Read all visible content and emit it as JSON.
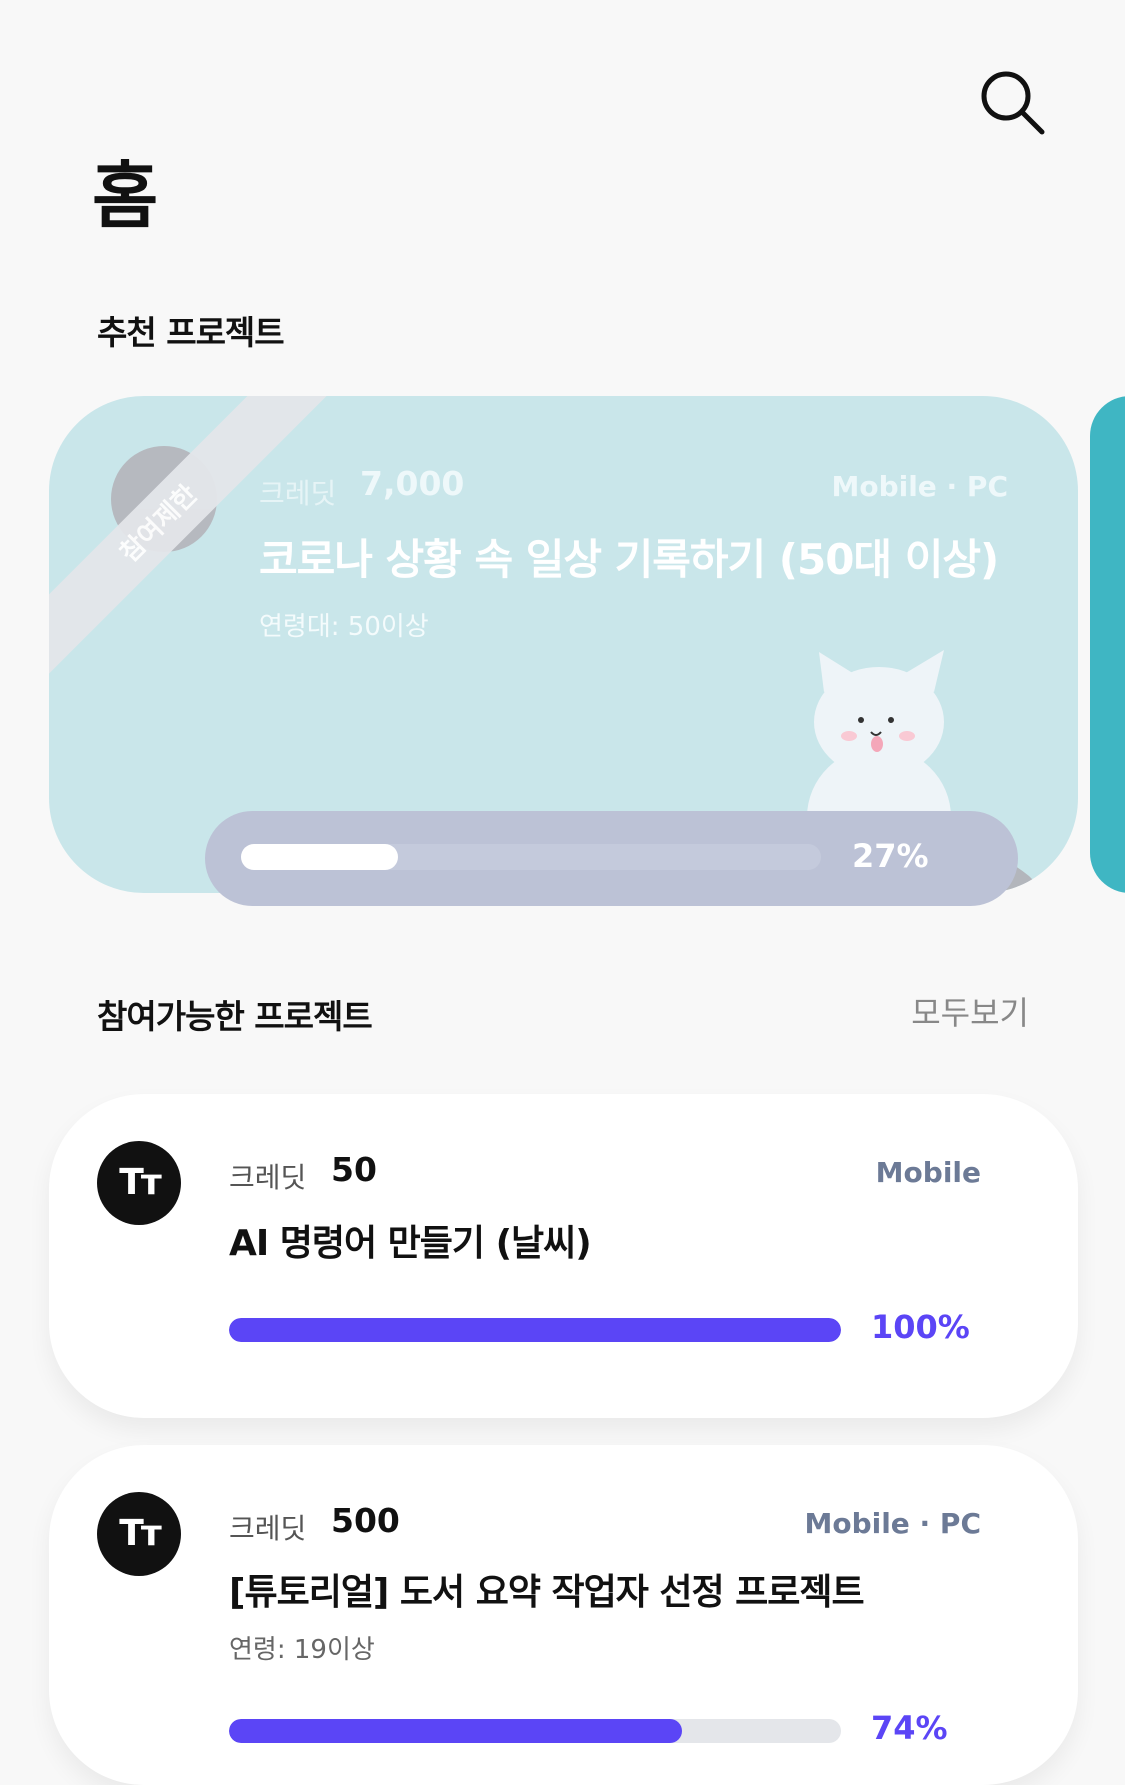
{
  "header": {
    "title": "홈",
    "search_icon": "search-icon"
  },
  "recommended": {
    "section_title": "추천 프로젝트",
    "ribbon": "참여제한",
    "credit_label": "크레딧",
    "credit": "7,000",
    "platform": "Mobile · PC",
    "title": "코로나 상황 속 일상 기록하기 (50대 이상)",
    "subtitle": "연령대: 50이상",
    "progress_label": "27%",
    "progress": 0.27,
    "colors": {
      "card": "#c9e6ea",
      "next_card": "#3fb6c3",
      "pill": "#bcc2d6"
    }
  },
  "available": {
    "section_title": "참여가능한 프로젝트",
    "view_all": "모두보기",
    "items": [
      {
        "avatar": "Tт",
        "credit_label": "크레딧",
        "credit": "50",
        "platform": "Mobile",
        "title": "AI 명령어 만들기 (날씨)",
        "subtitle": "",
        "progress_label": "100%",
        "progress": 1.0
      },
      {
        "avatar": "Tт",
        "credit_label": "크레딧",
        "credit": "500",
        "platform": "Mobile · PC",
        "title": "[튜토리얼] 도서 요약 작업자 선정 프로젝트",
        "subtitle": "연령: 19이상",
        "progress_label": "74%",
        "progress": 0.74
      }
    ],
    "accent": "#5b45f6"
  }
}
